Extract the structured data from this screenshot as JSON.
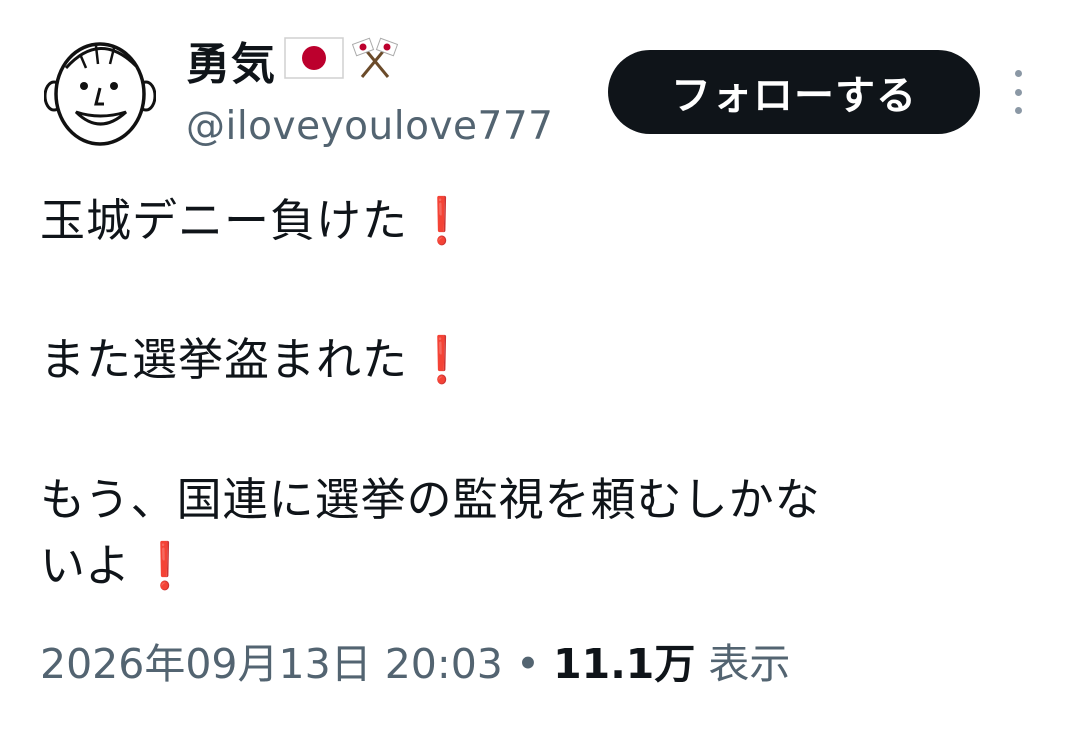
{
  "author": {
    "display_name": "勇気",
    "name_icons": [
      "japan-flag-icon",
      "crossed-flags-icon"
    ],
    "handle": "@iloveyoulove777",
    "avatar": "cartoon-face-avatar"
  },
  "actions": {
    "follow_label": "フォローする",
    "more_icon": "more-vertical-icon"
  },
  "tweet": {
    "lines": [
      "玉城デニー負けた",
      "また選挙盗まれた",
      "もう、国連に選挙の監視を頼むしかな",
      "いよ"
    ],
    "exclamation": "❗"
  },
  "meta": {
    "timestamp": "2026年09月13日 20:03",
    "separator": "•",
    "views_count": "11.1万",
    "views_label": "表示"
  },
  "colors": {
    "text": "#0f1419",
    "secondary": "#536471",
    "follow_bg": "#0f1419",
    "exclamation": "#e0251b",
    "flag_red": "#bc002d"
  }
}
